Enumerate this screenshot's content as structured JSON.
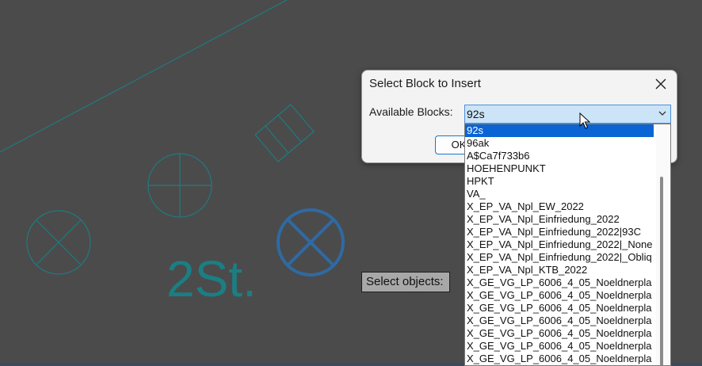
{
  "canvas": {
    "text_label": "2St."
  },
  "command_prompt": {
    "text": "Select objects:"
  },
  "dialog": {
    "title": "Select Block to Insert",
    "blocks_label": "Available Blocks:",
    "selected_block": "92s",
    "ok_button_label": "OK"
  },
  "dropdown": {
    "selected_index": 0,
    "items": [
      "92s",
      "96ak",
      "A$Ca7f733b6",
      "HOEHENPUNKT",
      "HPKT",
      "VA_",
      "X_EP_VA_Npl_EW_2022",
      "X_EP_VA_Npl_Einfriedung_2022",
      "X_EP_VA_Npl_Einfriedung_2022|93C",
      "X_EP_VA_Npl_Einfriedung_2022|_None",
      "X_EP_VA_Npl_Einfriedung_2022|_Obliq",
      "X_EP_VA_Npl_KTB_2022",
      "X_GE_VG_LP_6006_4_05_Noeldnerpla",
      "X_GE_VG_LP_6006_4_05_Noeldnerpla",
      "X_GE_VG_LP_6006_4_05_Noeldnerpla",
      "X_GE_VG_LP_6006_4_05_Noeldnerpla",
      "X_GE_VG_LP_6006_4_05_Noeldnerpla",
      "X_GE_VG_LP_6006_4_05_Noeldnerpla",
      "X_GE_VG_LP_6006_4_05_Noeldnerpla"
    ]
  },
  "colors": {
    "background": "#4b4b4b",
    "teal_geometry": "#1f7b80",
    "blue_symbol": "#2f6aa3",
    "selection": "#0a64d4"
  }
}
